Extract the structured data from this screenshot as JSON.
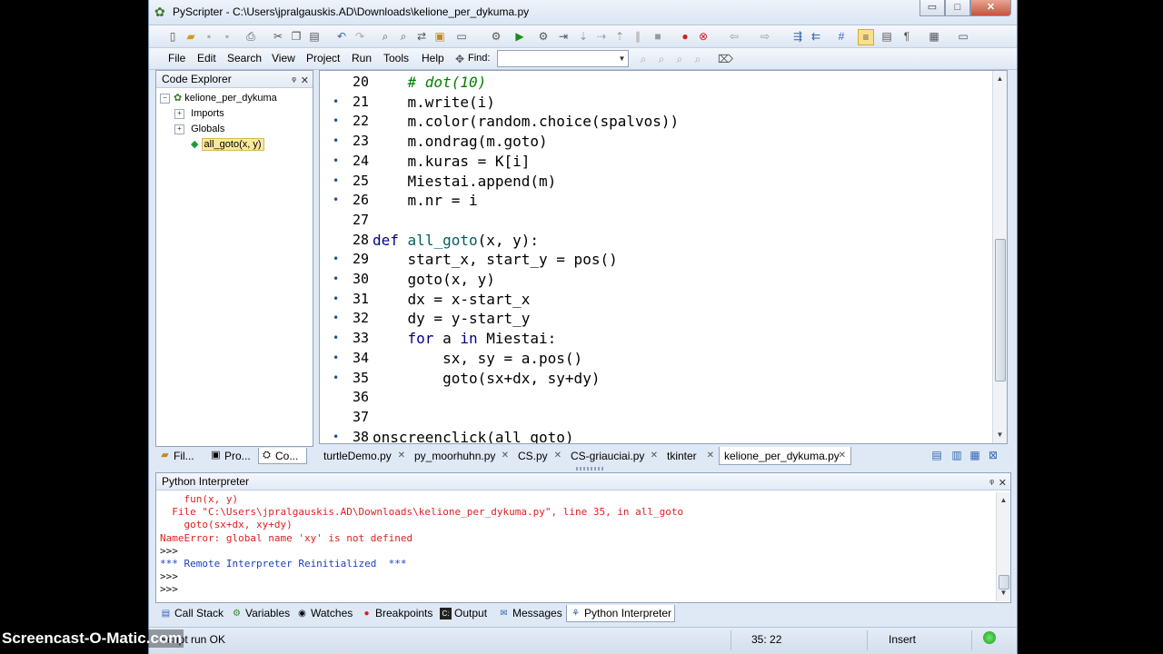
{
  "window": {
    "title": "PyScripter - C:\\Users\\jpralgauskis.AD\\Downloads\\kelione_per_dykuma.py",
    "controls": [
      "▭",
      "□",
      "✕"
    ]
  },
  "menu": [
    "File",
    "Edit",
    "Search",
    "View",
    "Project",
    "Run",
    "Tools",
    "Help"
  ],
  "find": {
    "label": "Find:",
    "value": ""
  },
  "code_explorer": {
    "title": "Code Explorer",
    "pin": "ᵠ",
    "close": "✕",
    "root": "kelione_per_dykuma",
    "children": [
      "Imports",
      "Globals"
    ],
    "selected": "all_goto(x, y)"
  },
  "left_tabs": [
    "Fil...",
    "Pro...",
    "Co..."
  ],
  "editor": {
    "lines": [
      {
        "n": "20",
        "dot": "",
        "code": "    # dot(10)"
      },
      {
        "n": "21",
        "dot": "•",
        "code": "    m.write(i)"
      },
      {
        "n": "22",
        "dot": "•",
        "code": "    m.color(random.choice(spalvos))"
      },
      {
        "n": "23",
        "dot": "•",
        "code": "    m.ondrag(m.goto)"
      },
      {
        "n": "24",
        "dot": "•",
        "code": "    m.kuras = K[i]"
      },
      {
        "n": "25",
        "dot": "•",
        "code": "    Miestai.append(m)"
      },
      {
        "n": "26",
        "dot": "•",
        "code": "    m.nr = i"
      },
      {
        "n": "27",
        "dot": "",
        "code": ""
      },
      {
        "n": "28",
        "dot": "",
        "code": "def all_goto(x, y):"
      },
      {
        "n": "29",
        "dot": "•",
        "code": "    start_x, start_y = pos()"
      },
      {
        "n": "30",
        "dot": "•",
        "code": "    goto(x, y)"
      },
      {
        "n": "31",
        "dot": "•",
        "code": "    dx = x-start_x"
      },
      {
        "n": "32",
        "dot": "•",
        "code": "    dy = y-start_y"
      },
      {
        "n": "33",
        "dot": "•",
        "code": "    for a in Miestai:"
      },
      {
        "n": "34",
        "dot": "•",
        "code": "        sx, sy = a.pos()"
      },
      {
        "n": "35",
        "dot": "•",
        "code": "        goto(sx+dx, sy+dy)"
      },
      {
        "n": "36",
        "dot": "",
        "code": ""
      },
      {
        "n": "37",
        "dot": "",
        "code": ""
      },
      {
        "n": "38",
        "dot": "•",
        "code": "onscreenclick(all_goto)"
      }
    ]
  },
  "editor_tabs": [
    {
      "label": "turtleDemo.py",
      "close": "✕"
    },
    {
      "label": "py_moorhuhn.py",
      "close": "✕"
    },
    {
      "label": "CS.py",
      "close": "✕"
    },
    {
      "label": "CS-griauciai.py",
      "close": "✕"
    },
    {
      "label": "tkinter",
      "close": "✕"
    },
    {
      "label": "kelione_per_dykuma.py",
      "close": "✕"
    }
  ],
  "interpreter": {
    "title": "Python Interpreter",
    "lines": [
      {
        "text": "    fun(x, y)",
        "style": "red"
      },
      {
        "text": "  File \"C:\\Users\\jpralgauskis.AD\\Downloads\\kelione_per_dykuma.py\", line 35, in all_goto",
        "style": "red"
      },
      {
        "text": "    goto(sx+dx, xy+dy)",
        "style": "red"
      },
      {
        "text": "NameError: global name 'xy' is not defined",
        "style": "red"
      },
      {
        "text": ">>>",
        "style": "gray"
      },
      {
        "text": "*** Remote Interpreter Reinitialized  ***",
        "style": "blue"
      },
      {
        "text": ">>>",
        "style": "gray"
      },
      {
        "text": ">>>",
        "style": "gray"
      }
    ]
  },
  "bottom_tabs": [
    "Call Stack",
    "Variables",
    "Watches",
    "Breakpoints",
    "Output",
    "Messages",
    "Python Interpreter"
  ],
  "status": {
    "message": "Script run OK",
    "position": "35: 22",
    "mode": "Insert"
  },
  "watermark": "Screencast-O-Matic.com"
}
